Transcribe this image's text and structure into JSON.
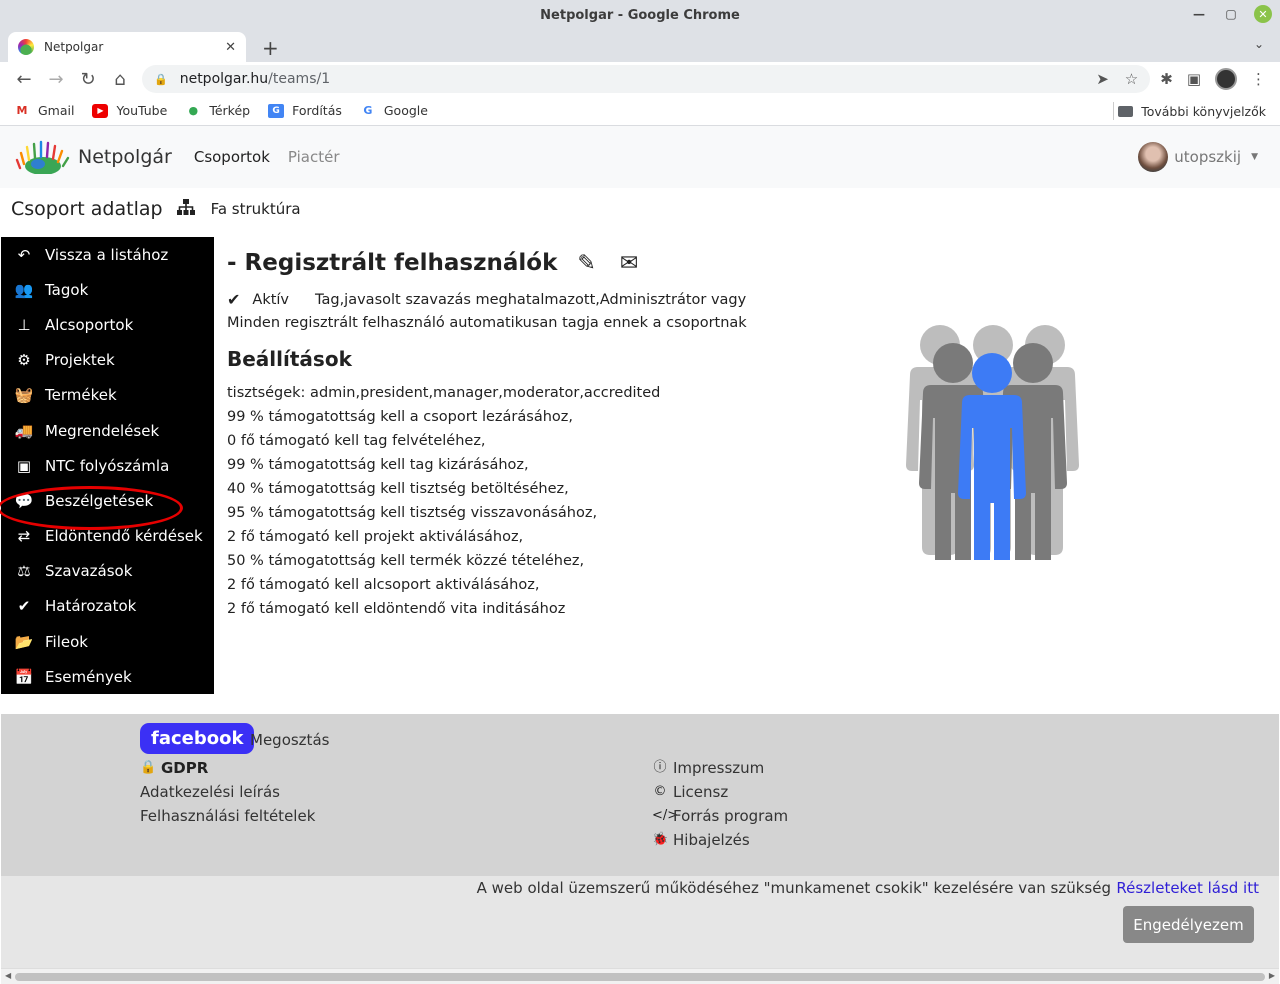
{
  "window": {
    "title": "Netpolgar - Google Chrome"
  },
  "tab": {
    "title": "Netpolgar"
  },
  "address": {
    "host": "netpolgar.hu",
    "path": "/teams/1"
  },
  "bookmarks": [
    {
      "label": "Gmail",
      "icon": "gmail-icon"
    },
    {
      "label": "YouTube",
      "icon": "youtube-icon"
    },
    {
      "label": "Térkép",
      "icon": "maps-icon"
    },
    {
      "label": "Fordítás",
      "icon": "translate-icon"
    },
    {
      "label": "Google",
      "icon": "google-icon"
    }
  ],
  "bookmarks_more": "További könyvjelzők",
  "navbar": {
    "brand": "Netpolgár",
    "links": [
      "Csoportok",
      "Piactér"
    ],
    "user": "utopszkij"
  },
  "page": {
    "title": "Csoport adatlap",
    "tree_label": "Fa struktúra"
  },
  "sidebar": {
    "items": [
      {
        "label": "Vissza a listához",
        "icon": "back-arrow-icon"
      },
      {
        "label": "Tagok",
        "icon": "users-icon"
      },
      {
        "label": "Alcsoportok",
        "icon": "sitemap-icon"
      },
      {
        "label": "Projektek",
        "icon": "cogs-icon"
      },
      {
        "label": "Termékek",
        "icon": "basket-icon"
      },
      {
        "label": "Megrendelések",
        "icon": "truck-icon"
      },
      {
        "label": "NTC folyószámla",
        "icon": "money-icon"
      },
      {
        "label": "Beszélgetések",
        "icon": "comments-icon"
      },
      {
        "label": "Eldöntendő kérdések",
        "icon": "retweet-icon"
      },
      {
        "label": "Szavazások",
        "icon": "balance-icon"
      },
      {
        "label": "Határozatok",
        "icon": "check-icon"
      },
      {
        "label": "Fileok",
        "icon": "folder-open-icon"
      },
      {
        "label": "Események",
        "icon": "calendar-icon"
      }
    ]
  },
  "main": {
    "heading": "- Regisztrált felhasználók",
    "status": "Aktív",
    "role": "Tag,javasolt szavazás meghatalmazott,Adminisztrátor vagy",
    "info": "Minden regisztrált felhasználó automatikusan tagja ennek a csoportnak",
    "settings_title": "Beállítások",
    "settings": [
      "tisztségek: admin,president,manager,moderator,accredited",
      "99 % támogatottság kell a csoport lezárásához,",
      "0 fő támogató kell tag felvételéhez,",
      "99 % támogatottság kell tag kizárásához,",
      "40 % támogatottság kell tisztség betöltéséhez,",
      "95 % támogatottság kell tisztség visszavonásához,",
      "2 fő támogató kell projekt aktiválásához,",
      "50 % támogatottság kell termék közzé tételéhez,",
      "2 fő támogató kell alcsoport aktiválásához,",
      "2 fő támogató kell eldöntendő vita inditásához"
    ]
  },
  "footer": {
    "facebook": "facebook",
    "share": "Megosztás",
    "left": [
      "GDPR",
      "Adatkezelési leírás",
      "Felhasználási feltételek"
    ],
    "right": [
      "Impresszum",
      "Licensz",
      "Forrás program",
      "Hibajelzés"
    ]
  },
  "cookie": {
    "text": "A web oldal üzemszerű működéséhez \"munkamenet csokik\" kezelésére van szükség",
    "link": "Részleteket lásd itt",
    "button": "Engedélyezem"
  },
  "colors": {
    "accent": "#3b30f5",
    "figure_blue": "#3d7bf5",
    "highlight": "#e60000"
  }
}
